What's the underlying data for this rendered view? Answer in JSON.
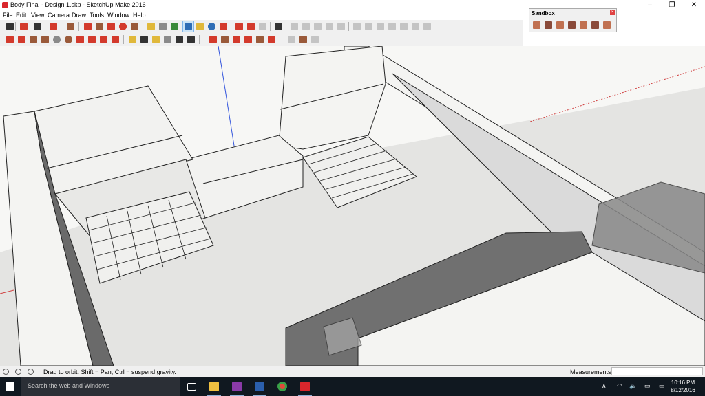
{
  "window": {
    "title": "Body Final - Design 1.skp - SketchUp Make 2016",
    "minimize_glyph": "–",
    "maximize_glyph": "❐",
    "close_glyph": "✕"
  },
  "menu": [
    "File",
    "Edit",
    "View",
    "Camera",
    "Draw",
    "Tools",
    "Window",
    "Help"
  ],
  "sandbox": {
    "title": "Sandbox",
    "close_glyph": "×"
  },
  "toolbar_colors": {
    "red": "#d33a2c",
    "blue": "#2f6db5",
    "yellow": "#e0b83a",
    "green": "#3a8a3a",
    "gray": "#8a8a8a",
    "brown": "#9a5a3a",
    "dark": "#333333",
    "light": "#c4c4c4"
  },
  "status": {
    "hint": "Drag to orbit. Shift = Pan, Ctrl = suspend gravity.",
    "measurements_label": "Measurements",
    "measurements_value": ""
  },
  "taskbar": {
    "search_placeholder": "Search the web and Windows",
    "time": "10:16 PM",
    "date": "8/12/2016",
    "tray_up": "∧",
    "tray_volume": "🔈",
    "tray_notify": "▭"
  }
}
